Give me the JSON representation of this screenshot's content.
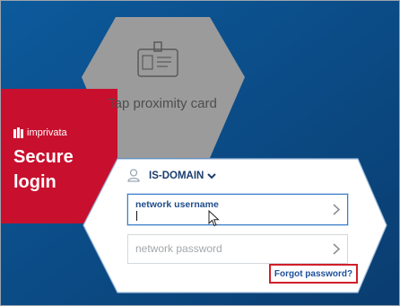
{
  "brand": {
    "name": "imprivata"
  },
  "panels": {
    "secure_login": "Secure login",
    "proximity": "Tap proximity card"
  },
  "login": {
    "domain": "IS-DOMAIN",
    "username_label": "network username",
    "username_value": "",
    "password_placeholder": "network password",
    "forgot_password": "Forgot password?"
  },
  "colors": {
    "background": "#0b4a84",
    "brand_red": "#c8102e",
    "proximity_gray": "#9b9b9b",
    "link_blue": "#1d4f9c",
    "highlight_red": "#d01f2a"
  },
  "icons": {
    "brand": "imprivata-logo-icon",
    "proximity": "badge-card-icon",
    "user": "user-icon",
    "domain_dropdown": "chevron-down-icon",
    "field_next": "chevron-right-icon",
    "cursor": "mouse-pointer-icon"
  }
}
